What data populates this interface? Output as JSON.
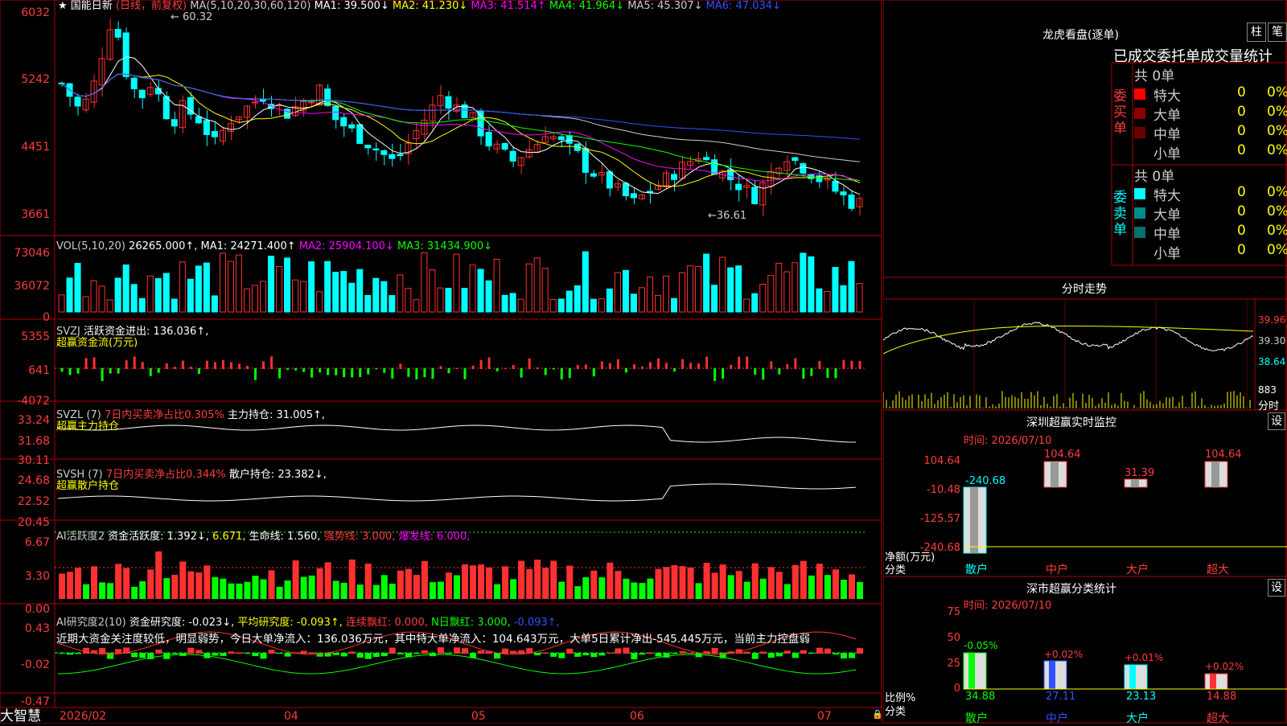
{
  "header": {
    "title": "国能日新",
    "period": "(日线，前复权)",
    "ma_label": "MA(5,10,20,30,60,120)",
    "ma": [
      "MA1: 39.500↓",
      "MA2: 41.230↓",
      "MA3: 41.514↑",
      "MA4: 41.964↓",
      "MA5: 45.307↓",
      "MA6: 47.034↓"
    ],
    "ma_colors": [
      "#ffffff",
      "#ffff00",
      "#ff00ff",
      "#00ff00",
      "#cccccc",
      "#3050ff"
    ]
  },
  "price_axis": [
    "6032",
    "5242",
    "4451",
    "3661"
  ],
  "price_annotations": {
    "high": "60.32",
    "low": "36.61"
  },
  "vol": {
    "label": "VOL(5,10,20)",
    "value": "26265.000↑,",
    "ma": [
      "MA1: 24271.400↑",
      "MA2: 25904.100↓",
      "MA3: 31434.900↓"
    ],
    "axis": [
      "73046",
      "36072",
      "0"
    ]
  },
  "svzj": {
    "label": "SVZJ",
    "text": "活跃资金进出: 136.036↑,",
    "sub": "超赢资金流(万元)",
    "axis": [
      "5355",
      "641",
      "-4072"
    ]
  },
  "svzl": {
    "label": "SVZL (7)",
    "ratio": "7日内买卖净占比0.305%",
    "hold": "主力持仓: 31.005↑,",
    "sub": "超赢主力持仓",
    "axis": [
      "33.24",
      "31.68",
      "30.11"
    ]
  },
  "svsh": {
    "label": "SVSH (7)",
    "ratio": "7日内买卖净占比0.344%",
    "hold": "散户持仓: 23.382↓,",
    "sub": "超赢散户持仓",
    "axis": [
      "24.68",
      "22.52",
      "20.45"
    ]
  },
  "ai1": {
    "label": "AI活跃度2",
    "a": "资金活跃度: 1.392↓,",
    "b": "6.671,",
    "c": "生命线: 1.560,",
    "d": "强势线: 3.000,",
    "e": "爆发线: 6.000,",
    "axis": [
      "6.67",
      "3.30",
      "0.00"
    ]
  },
  "ai2": {
    "label": "AI研究度2(10)",
    "a": "资金研究度: -0.023↓,",
    "b": "平均研究度: -0.093↑,",
    "c": "连续飘红: 0.000,",
    "d": "N日飘红: 3.000,",
    "e": "-0.093↑,",
    "comment": "近期大资金关注度较低，明显弱势，今日大单净流入：136.036万元，其中特大单净流入：104.643万元，大单5日累计净出-545.445万元，当前主力控盘弱",
    "axis": [
      "0.43",
      "-0.02",
      "-0.47"
    ]
  },
  "date_axis": [
    "2026/02",
    "04",
    "05",
    "06",
    "07"
  ],
  "brand": "大智慧",
  "right": {
    "lhb_title": "龙虎看盘(逐单)",
    "btn_zhu": "柱",
    "btn_bi": "笔",
    "tabs_title": "已成交委托单成交量统计",
    "buy": {
      "side": "委买单",
      "total": "共 0单",
      "rows": [
        {
          "name": "特大",
          "val": "0",
          "pct": "0%",
          "color": "#ff0000"
        },
        {
          "name": "大单",
          "val": "0",
          "pct": "0%",
          "color": "#8b0000"
        },
        {
          "name": "中单",
          "val": "0",
          "pct": "0%",
          "color": "#6b0000"
        },
        {
          "name": "小单",
          "val": "0",
          "pct": "0%",
          "color": "#000000"
        }
      ]
    },
    "sell": {
      "side": "委卖单",
      "total": "共 0单",
      "rows": [
        {
          "name": "特大",
          "val": "0",
          "pct": "0%",
          "color": "#00ffff"
        },
        {
          "name": "大单",
          "val": "0",
          "pct": "0%",
          "color": "#008b8b"
        },
        {
          "name": "中单",
          "val": "0",
          "pct": "0%",
          "color": "#007070"
        },
        {
          "name": "小单",
          "val": "0",
          "pct": "0%",
          "color": "#000000"
        }
      ]
    },
    "fenshi": {
      "title": "分时走势",
      "axis": [
        "39.96",
        "39.30",
        "38.64"
      ],
      "vol": "883",
      "vol_unit": "分时"
    },
    "monitor": {
      "title": "深圳超赢实时监控",
      "btn": "设",
      "time": "时间: 2026/07/10",
      "axis": [
        "104.64",
        "-10.48",
        "-125.57",
        "-240.68"
      ],
      "ylabel1": "净额(万元)",
      "ylabel2": "分类",
      "cats": [
        "散户",
        "中户",
        "大户",
        "超大"
      ],
      "values": [
        "-240.68",
        "104.64",
        "31.39",
        "104.64"
      ]
    },
    "classify": {
      "title": "深市超赢分类统计",
      "btn": "设",
      "time": "时间: 2026/07/10",
      "axis": [
        "75",
        "50",
        "25",
        "0"
      ],
      "ylabel1": "比例%",
      "ylabel2": "分类",
      "cats": [
        "散户",
        "中户",
        "大户",
        "超大"
      ],
      "values": [
        "34.88",
        "27.11",
        "23.13",
        "14.88"
      ],
      "changes": [
        "-0.05%",
        "+0.02%",
        "+0.01%",
        "+0.02%"
      ]
    }
  }
}
